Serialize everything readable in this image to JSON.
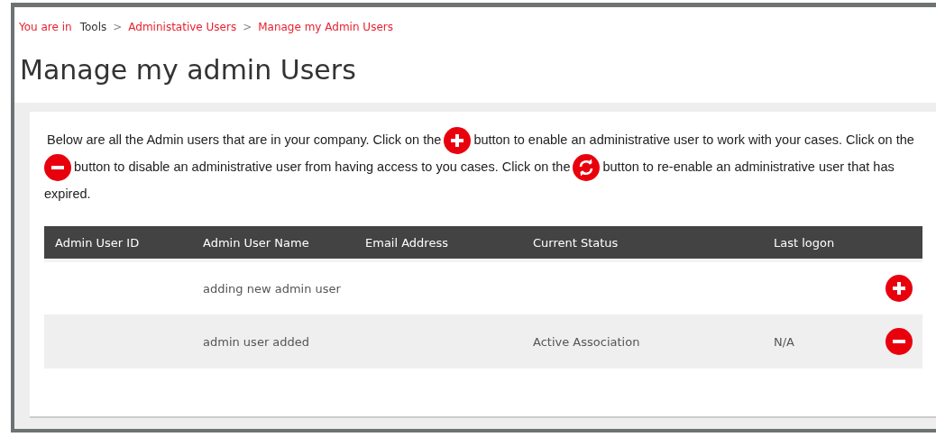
{
  "breadcrumb": [
    {
      "label": "You are in",
      "kind": "prefix"
    },
    {
      "label": "Tools",
      "kind": "plain"
    },
    {
      "label": ">",
      "kind": "separator"
    },
    {
      "label": "Administative Users",
      "kind": "link"
    },
    {
      "label": ">",
      "kind": "separator"
    },
    {
      "label": "Manage my Admin Users",
      "kind": "link"
    }
  ],
  "title": "Manage my admin Users",
  "intro": [
    {
      "kind": "text",
      "text": "Below are all the Admin users that are in your company. Click on the"
    },
    {
      "kind": "add"
    },
    {
      "kind": "text",
      "text": "button to enable an administrative user to work with your cases. Click on the"
    },
    {
      "kind": "remove"
    },
    {
      "kind": "text",
      "text": "button to disable an administrative user from having access to you cases. Click on the"
    },
    {
      "kind": "refresh"
    },
    {
      "kind": "text",
      "text": "button to re-enable an administrative user that has expired."
    }
  ],
  "table": {
    "columns": [
      "Admin User ID",
      "Admin User Name",
      "Email Address",
      "Current Status",
      "Last logon"
    ],
    "rows": [
      {
        "cells": [
          "",
          "adding new admin user",
          "",
          "",
          ""
        ],
        "kind": "add"
      },
      {
        "cells": [
          "",
          "admin user added",
          "",
          "Active Association",
          "N/A"
        ],
        "kind": "remove"
      }
    ]
  }
}
